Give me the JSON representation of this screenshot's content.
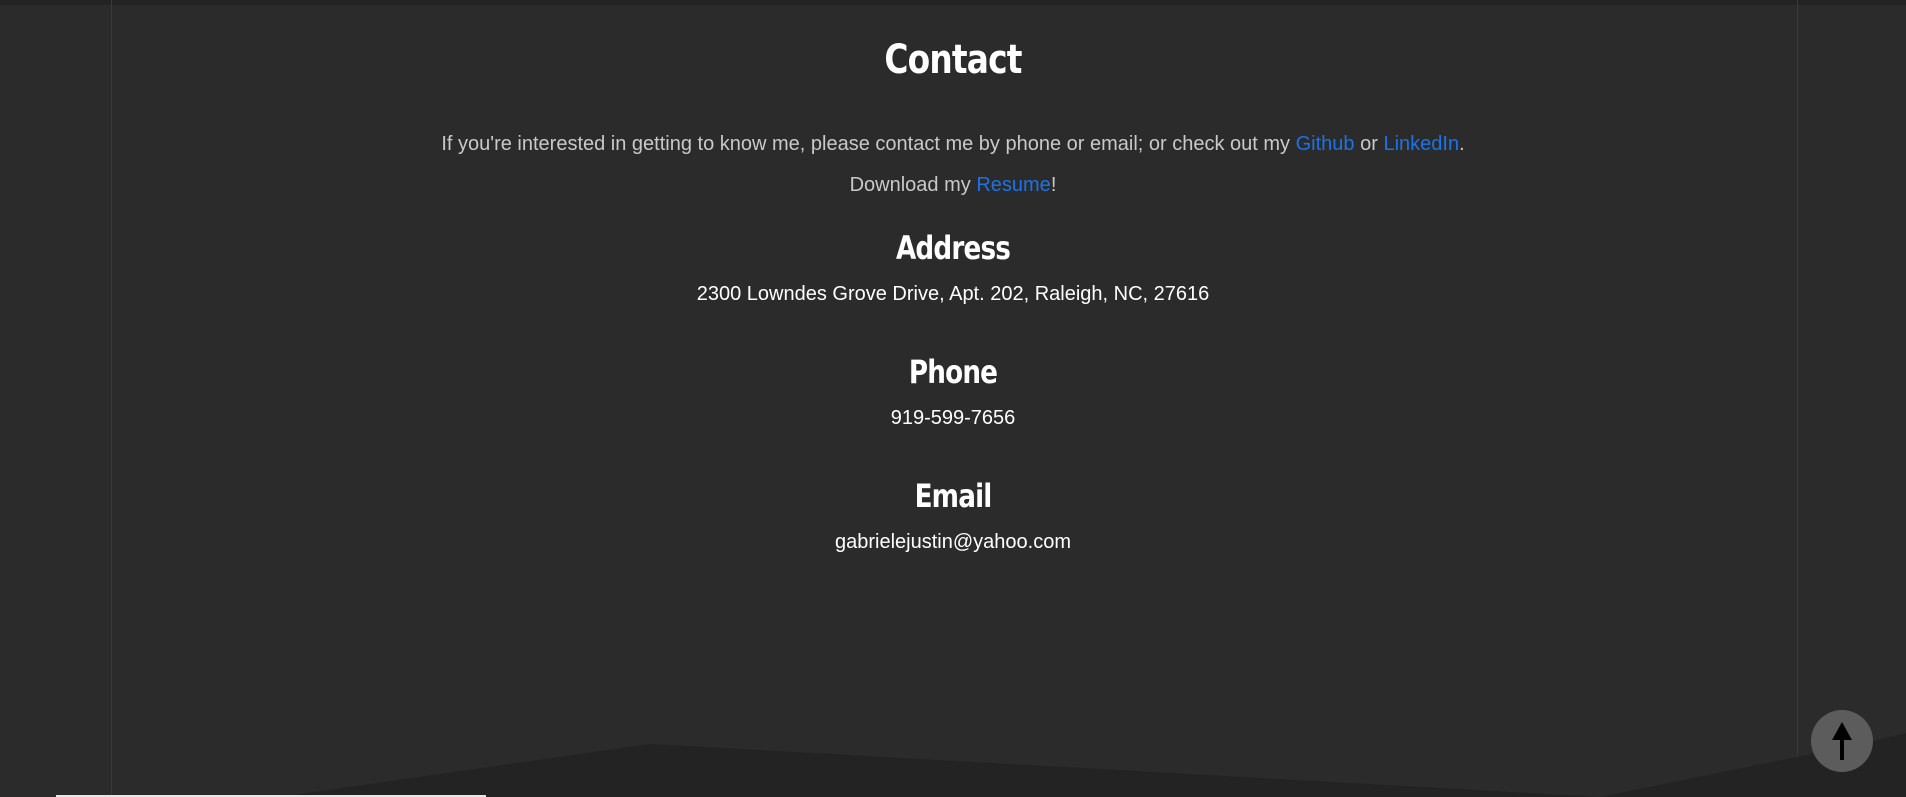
{
  "contact": {
    "title": "Contact",
    "intro_prefix": "If you're interested in getting to know me, please contact me by phone or email; or check out my ",
    "github_label": "Github",
    "intro_or": " or ",
    "linkedin_label": "LinkedIn",
    "intro_suffix": ".",
    "download_prefix": "Download my ",
    "resume_label": "Resume",
    "download_suffix": "!"
  },
  "address": {
    "heading": "Address",
    "value": "2300 Lowndes Grove Drive, Apt. 202, Raleigh, NC, 27616"
  },
  "phone": {
    "heading": "Phone",
    "value": "919-599-7656"
  },
  "email": {
    "heading": "Email",
    "value": "gabrielejustin@yahoo.com"
  },
  "scroll_top": {
    "icon": "arrow-up-icon"
  },
  "colors": {
    "background": "#2b2b2b",
    "link": "#1a73e8",
    "heading": "#ffffff",
    "body_text": "#c9c9c9"
  }
}
